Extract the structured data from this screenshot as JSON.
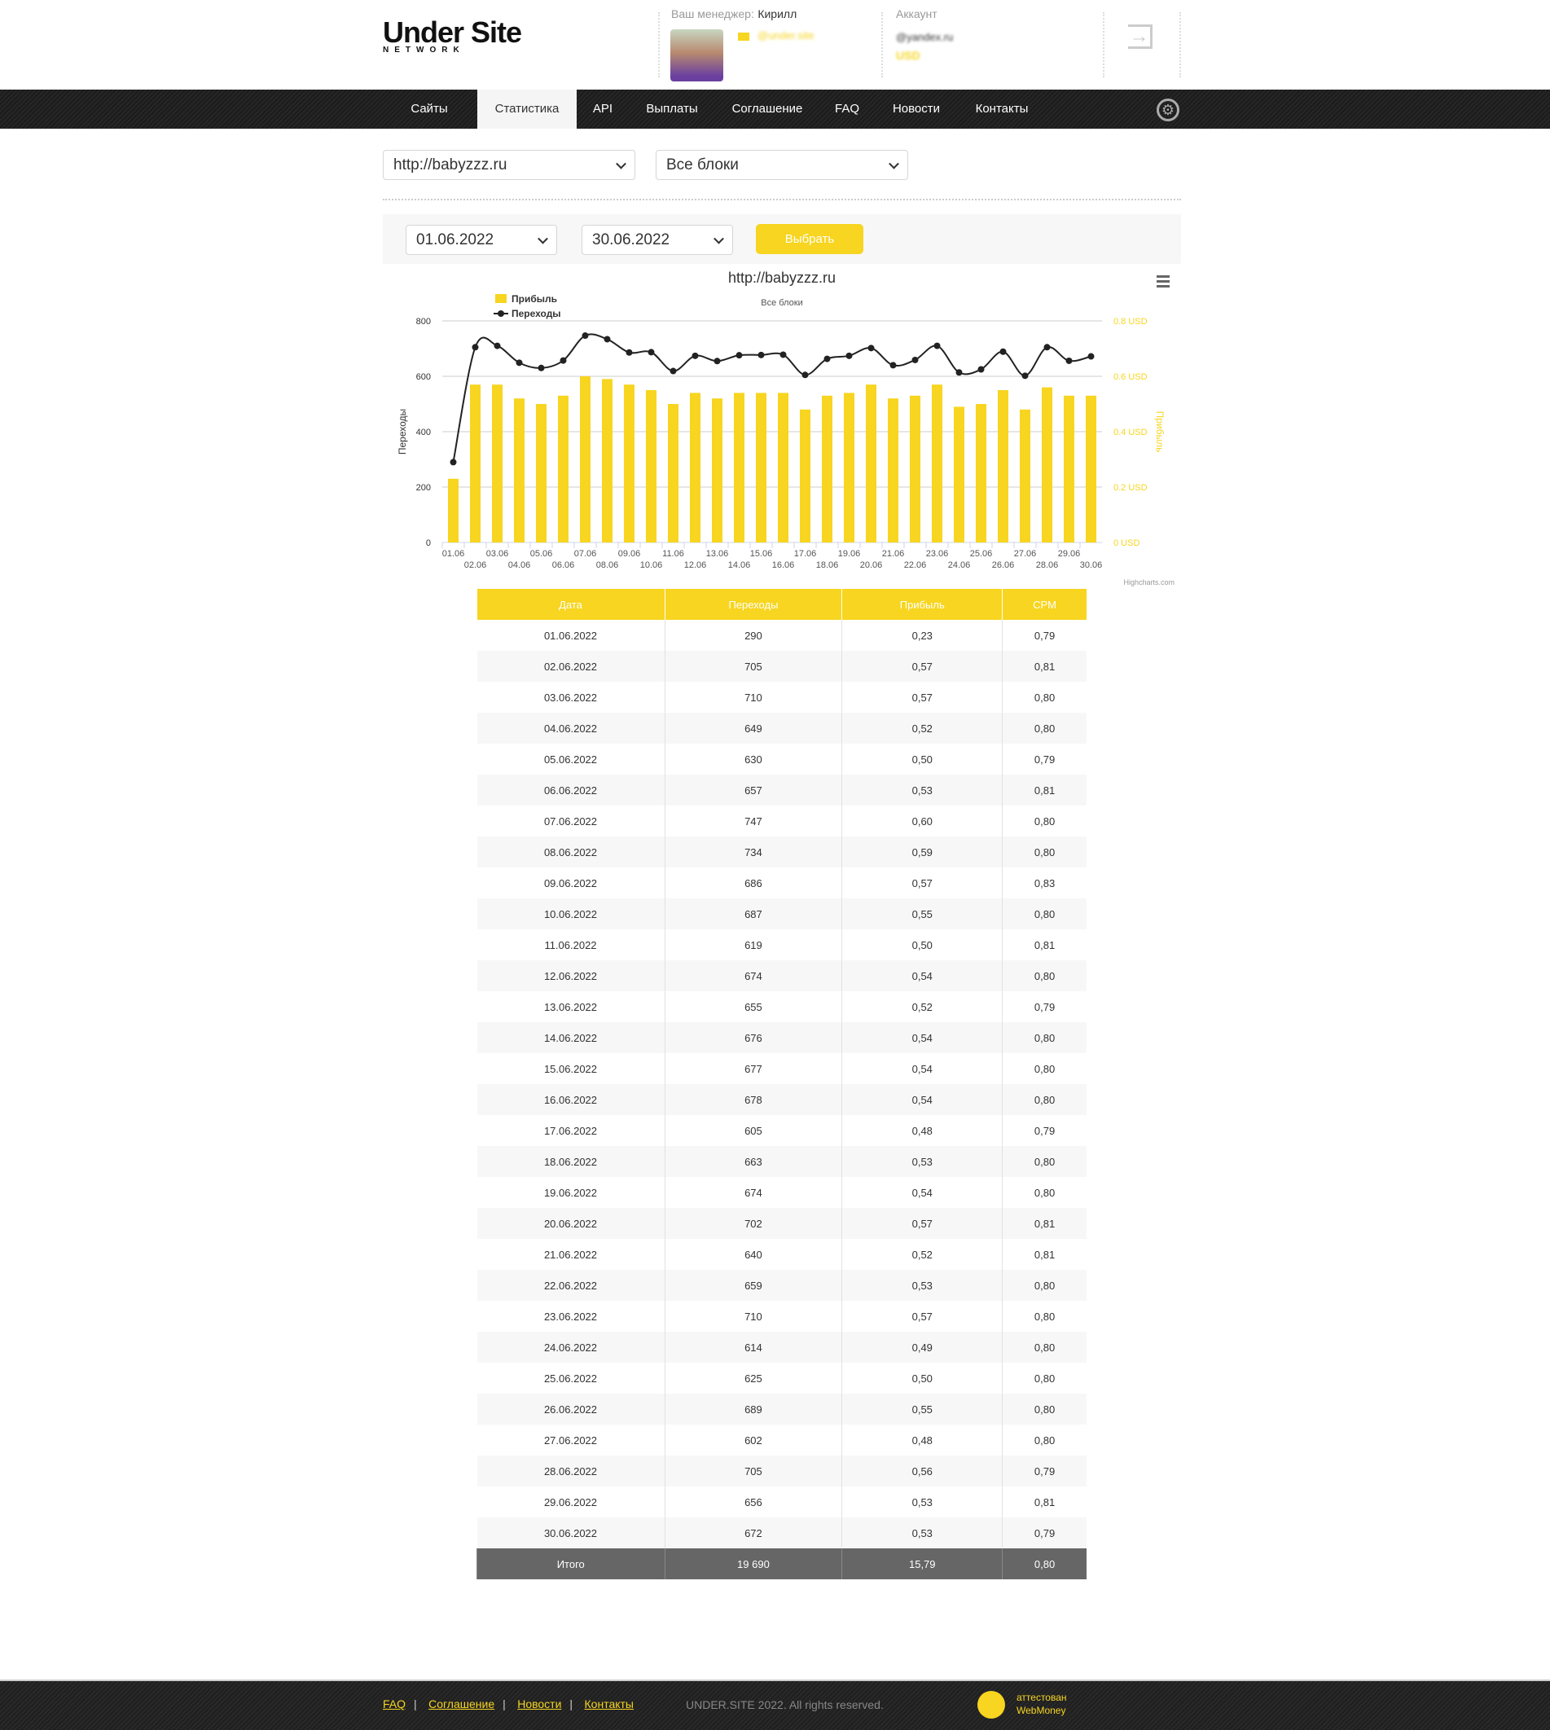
{
  "header": {
    "logo_main": "Under Site",
    "logo_sub": "NETWORK",
    "manager_label": "Ваш менеджер:",
    "manager_name": "Кирилл",
    "manager_email": "@under.site",
    "account_label": "Аккаунт",
    "account_email": "@yandex.ru",
    "balance": "USD"
  },
  "nav": {
    "items": [
      {
        "label": "Сайты"
      },
      {
        "label": "Статистика",
        "active": true
      },
      {
        "label": "API"
      },
      {
        "label": "Выплаты"
      },
      {
        "label": "Соглашение"
      },
      {
        "label": "FAQ"
      },
      {
        "label": "Новости"
      },
      {
        "label": "Контакты"
      }
    ]
  },
  "filters": {
    "site": "http://babyzzz.ru",
    "blocks": "Все блоки",
    "date_from": "01.06.2022",
    "date_to": "30.06.2022",
    "submit": "Выбрать"
  },
  "colors": {
    "accent": "#f7d520",
    "line": "#222222"
  },
  "chart_data": {
    "type": "bar+line",
    "title": "http://babyzzz.ru",
    "subtitle": "Все блоки",
    "credit": "Highcharts.com",
    "categories": [
      "01.06",
      "02.06",
      "03.06",
      "04.06",
      "05.06",
      "06.06",
      "07.06",
      "08.06",
      "09.06",
      "10.06",
      "11.06",
      "12.06",
      "13.06",
      "14.06",
      "15.06",
      "16.06",
      "17.06",
      "18.06",
      "19.06",
      "20.06",
      "21.06",
      "22.06",
      "23.06",
      "24.06",
      "25.06",
      "26.06",
      "27.06",
      "28.06",
      "29.06",
      "30.06"
    ],
    "y_left": {
      "label": "Переходы",
      "ticks": [
        "0",
        "200",
        "400",
        "600",
        "800"
      ],
      "range": [
        0,
        800
      ]
    },
    "y_right": {
      "label": "Прибыль",
      "ticks": [
        "0 USD",
        "0.2 USD",
        "0.4 USD",
        "0.6 USD",
        "0.8 USD"
      ],
      "range": [
        0,
        0.8
      ]
    },
    "legend": "top-left",
    "grid": true,
    "series": [
      {
        "name": "Прибыль",
        "type": "bar",
        "axis": "right",
        "values": [
          0.23,
          0.57,
          0.57,
          0.52,
          0.5,
          0.53,
          0.6,
          0.59,
          0.57,
          0.55,
          0.5,
          0.54,
          0.52,
          0.54,
          0.54,
          0.54,
          0.48,
          0.53,
          0.54,
          0.57,
          0.52,
          0.53,
          0.57,
          0.49,
          0.5,
          0.55,
          0.48,
          0.56,
          0.53,
          0.53
        ]
      },
      {
        "name": "Переходы",
        "type": "line",
        "axis": "left",
        "values": [
          290,
          705,
          710,
          649,
          630,
          657,
          747,
          734,
          686,
          687,
          619,
          674,
          655,
          676,
          677,
          678,
          605,
          663,
          674,
          702,
          640,
          659,
          710,
          614,
          625,
          689,
          602,
          705,
          656,
          672
        ]
      }
    ]
  },
  "table": {
    "headers": [
      "Дата",
      "Переходы",
      "Прибыль",
      "CPM"
    ],
    "rows": [
      [
        "01.06.2022",
        "290",
        "0,23",
        "0,79"
      ],
      [
        "02.06.2022",
        "705",
        "0,57",
        "0,81"
      ],
      [
        "03.06.2022",
        "710",
        "0,57",
        "0,80"
      ],
      [
        "04.06.2022",
        "649",
        "0,52",
        "0,80"
      ],
      [
        "05.06.2022",
        "630",
        "0,50",
        "0,79"
      ],
      [
        "06.06.2022",
        "657",
        "0,53",
        "0,81"
      ],
      [
        "07.06.2022",
        "747",
        "0,60",
        "0,80"
      ],
      [
        "08.06.2022",
        "734",
        "0,59",
        "0,80"
      ],
      [
        "09.06.2022",
        "686",
        "0,57",
        "0,83"
      ],
      [
        "10.06.2022",
        "687",
        "0,55",
        "0,80"
      ],
      [
        "11.06.2022",
        "619",
        "0,50",
        "0,81"
      ],
      [
        "12.06.2022",
        "674",
        "0,54",
        "0,80"
      ],
      [
        "13.06.2022",
        "655",
        "0,52",
        "0,79"
      ],
      [
        "14.06.2022",
        "676",
        "0,54",
        "0,80"
      ],
      [
        "15.06.2022",
        "677",
        "0,54",
        "0,80"
      ],
      [
        "16.06.2022",
        "678",
        "0,54",
        "0,80"
      ],
      [
        "17.06.2022",
        "605",
        "0,48",
        "0,79"
      ],
      [
        "18.06.2022",
        "663",
        "0,53",
        "0,80"
      ],
      [
        "19.06.2022",
        "674",
        "0,54",
        "0,80"
      ],
      [
        "20.06.2022",
        "702",
        "0,57",
        "0,81"
      ],
      [
        "21.06.2022",
        "640",
        "0,52",
        "0,81"
      ],
      [
        "22.06.2022",
        "659",
        "0,53",
        "0,80"
      ],
      [
        "23.06.2022",
        "710",
        "0,57",
        "0,80"
      ],
      [
        "24.06.2022",
        "614",
        "0,49",
        "0,80"
      ],
      [
        "25.06.2022",
        "625",
        "0,50",
        "0,80"
      ],
      [
        "26.06.2022",
        "689",
        "0,55",
        "0,80"
      ],
      [
        "27.06.2022",
        "602",
        "0,48",
        "0,80"
      ],
      [
        "28.06.2022",
        "705",
        "0,56",
        "0,79"
      ],
      [
        "29.06.2022",
        "656",
        "0,53",
        "0,81"
      ],
      [
        "30.06.2022",
        "672",
        "0,53",
        "0,79"
      ]
    ],
    "total": [
      "Итого",
      "19 690",
      "15,79",
      "0,80"
    ]
  },
  "footer": {
    "links": [
      "FAQ",
      "Соглашение",
      "Новости",
      "Контакты"
    ],
    "copyright": "UNDER.SITE 2022. All rights reserved.",
    "badge_line1": "аттестован",
    "badge_line2": "WebMoney"
  }
}
